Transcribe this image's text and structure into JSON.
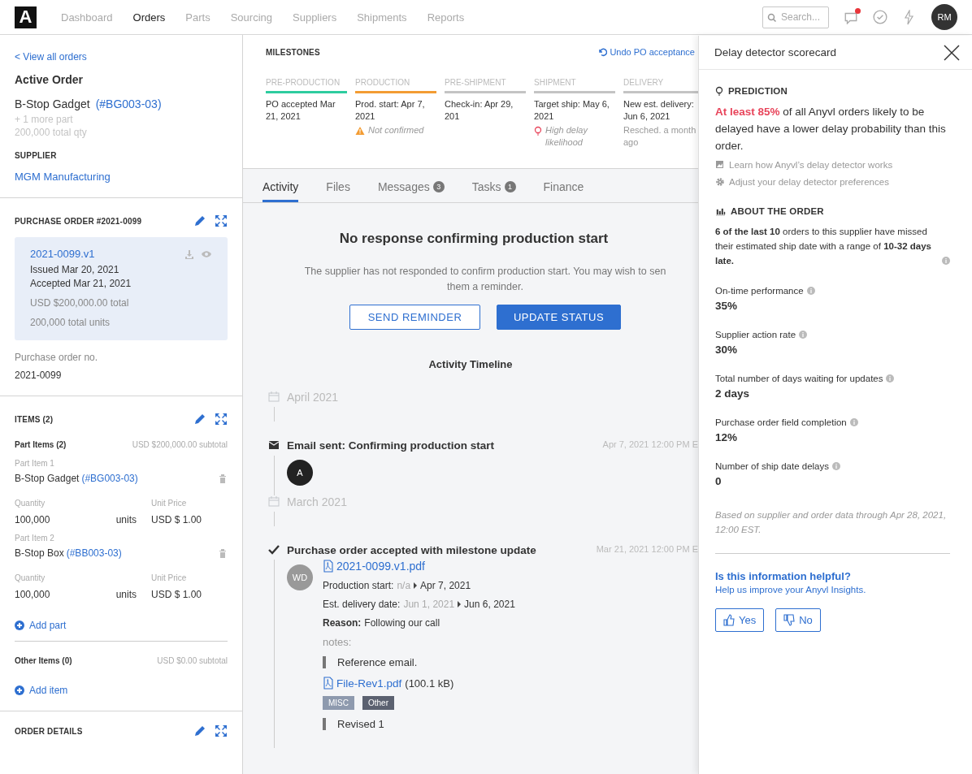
{
  "nav": {
    "logo": "A",
    "items": [
      {
        "label": "Dashboard",
        "selected": false
      },
      {
        "label": "Orders",
        "selected": true
      },
      {
        "label": "Parts",
        "selected": false
      },
      {
        "label": "Sourcing",
        "selected": false
      },
      {
        "label": "Suppliers",
        "selected": false
      },
      {
        "label": "Shipments",
        "selected": false
      },
      {
        "label": "Reports",
        "selected": false
      }
    ],
    "search": {
      "placeholder": "Search..."
    },
    "notifications_unread": true,
    "avatar": "RM"
  },
  "order": {
    "back_link": "< View all orders",
    "heading": "Active Order",
    "product": "B-Stop Gadget",
    "product_code": "(#BG003-03)",
    "more_parts": "+ 1 more part",
    "total_qty": "200,000 total qty",
    "supplier_label": "SUPPLIER",
    "supplier": "MGM Manufacturing"
  },
  "purchase_order": {
    "title": "PURCHASE ORDER #2021-0099",
    "document": {
      "link": "2021-0099.v1",
      "issued": "Issued Mar 20, 2021",
      "accepted": "Accepted Mar 21, 2021",
      "total": "USD $200,000.00 total",
      "units": "200,000 total units"
    },
    "field_label": "Purchase order no.",
    "field_value": "2021-0099"
  },
  "items": {
    "title": "ITEMS (2)",
    "part_heading": "Part Items (2)",
    "part_subtotal": "USD $200,000.00 subtotal",
    "parts": [
      {
        "label": "Part Item 1",
        "name": "B-Stop Gadget",
        "code": "(#BG003-03)",
        "qty_label": "Quantity",
        "qty": "100,000",
        "unit": "units",
        "price_label": "Unit Price",
        "price": "USD $ 1.00"
      },
      {
        "label": "Part Item 2",
        "name": "B-Stop Box",
        "code": "(#BB003-03)",
        "qty_label": "Quantity",
        "qty": "100,000",
        "unit": "units",
        "price_label": "Unit Price",
        "price": "USD $ 1.00"
      }
    ],
    "add_part": "Add part",
    "other_heading": "Other Items (0)",
    "other_subtotal": "USD $0.00 subtotal",
    "add_item": "Add item"
  },
  "order_details": {
    "title": "ORDER DETAILS"
  },
  "milestones": {
    "title": "MILESTONES",
    "undo": "Undo PO acceptance",
    "stages": [
      {
        "label": "PRE-PRODUCTION",
        "color": "#2ecc9f",
        "text": "PO accepted Mar 21, 2021"
      },
      {
        "label": "PRODUCTION",
        "color": "#f39c33",
        "text": "Prod. start: Apr 7, 2021",
        "note": {
          "kind": "warning",
          "text": "Not confirmed"
        }
      },
      {
        "label": "PRE-SHIPMENT",
        "color": "#c4c4c4",
        "text": "Check-in: Apr 29, 201"
      },
      {
        "label": "SHIPMENT",
        "color": "#c4c4c4",
        "text": "Target ship: May 6, 2021",
        "note": {
          "kind": "delay",
          "text": "High delay likelihood"
        }
      },
      {
        "label": "DELIVERY",
        "color": "#c4c4c4",
        "text": "New est. delivery: Jun 6, 2021",
        "note": {
          "kind": "plain",
          "text": "Resched. a month ago"
        }
      }
    ]
  },
  "tabs": [
    {
      "label": "Activity",
      "selected": true
    },
    {
      "label": "Files",
      "selected": false
    },
    {
      "label": "Messages",
      "selected": false,
      "badge": "3"
    },
    {
      "label": "Tasks",
      "selected": false,
      "badge": "1"
    },
    {
      "label": "Finance",
      "selected": false
    }
  ],
  "alert": {
    "title": "No response confirming production start",
    "lines": [
      "The supplier has not responded to confirm production start. You may wish to sen",
      "them a reminder."
    ],
    "buttons": [
      {
        "label": "SEND REMINDER",
        "kind": "outline"
      },
      {
        "label": "UPDATE STATUS",
        "kind": "primary"
      }
    ]
  },
  "timeline": {
    "title": "Activity Timeline",
    "entries": [
      {
        "kind": "month",
        "label": "April 2021"
      },
      {
        "kind": "event",
        "title": "Email sent: Confirming production start",
        "time": "Apr 7, 2021 12:00 PM E",
        "avatar": {
          "initials": "A",
          "kind": "dark"
        }
      },
      {
        "kind": "month",
        "label": "March 2021"
      },
      {
        "kind": "event",
        "title": "Purchase order accepted with milestone update",
        "time": "Mar 21, 2021 12:00 PM E",
        "avatar": {
          "initials": "WD",
          "kind": "grey"
        },
        "details": {
          "file": "2021-0099.v1.pdf",
          "changes": [
            {
              "label": "Production start:",
              "old": "n/a",
              "new": "Apr 7, 2021"
            },
            {
              "label": "Est. delivery date:",
              "old": "Jun 1, 2021",
              "new": "Jun 6, 2021"
            }
          ],
          "reason_label": "Reason:",
          "reason": "Following our call",
          "notes_label": "notes:",
          "note": "Reference email.",
          "attachment": {
            "name": "File-Rev1.pdf",
            "size": "(100.1 kB)"
          },
          "tags": [
            {
              "label": "MISC",
              "color": "#8e9aae"
            },
            {
              "label": "Other",
              "color": "#5b6170"
            }
          ],
          "revision": "Revised 1"
        }
      }
    ]
  },
  "scorecard": {
    "title": "Delay detector scorecard",
    "prediction_heading": "PREDICTION",
    "prediction_highlight": "At least 85%",
    "prediction_text": " of all Anyvl orders likely to be delayed have a lower delay probability than this order.",
    "links": [
      {
        "label": "Learn how Anyvl’s delay detector works"
      },
      {
        "label": "Adjust your delay detector preferences"
      }
    ],
    "about_heading": "ABOUT THE ORDER",
    "summary": "**6 of the last 10** orders to this supplier have missed their estimated ship date with a range of **10-32 days late.**",
    "metrics": [
      {
        "label": "On-time performance",
        "value": "35%"
      },
      {
        "label": "Supplier action rate",
        "value": "30%"
      },
      {
        "label": "Total number of days waiting for updates",
        "value": "2 days"
      },
      {
        "label": "Purchase order field completion",
        "value": "12%"
      },
      {
        "label": "Number of ship date delays",
        "value": "0"
      }
    ],
    "footnote": "Based on supplier and order data through Apr 28, 2021, 12:00 EST.",
    "question": "Is this information helpful?",
    "improve_link": "Help us improve your Anyvl Insights.",
    "buttons": [
      {
        "label": "Yes",
        "kind": "up"
      },
      {
        "label": "No",
        "kind": "down"
      }
    ]
  }
}
